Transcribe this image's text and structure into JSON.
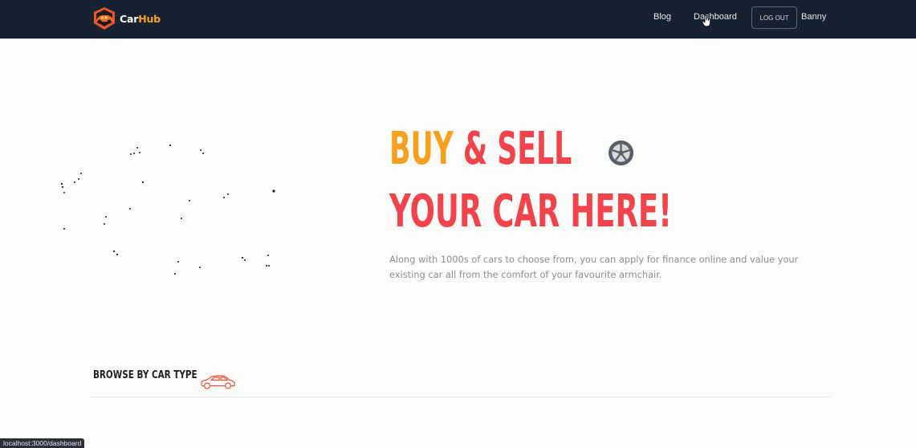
{
  "navbar": {
    "brand": {
      "logo_icon": "carhub-logo-icon",
      "name_part1": "Car",
      "name_part2": "Hub",
      "accent_color": "#f5a524"
    },
    "links": {
      "blog": "Blog",
      "dashboard": "Dashboard"
    },
    "logout_label": "LOG OUT",
    "username": "Banny",
    "background": "#17212f"
  },
  "hero": {
    "title_word1": "BUY",
    "title_word2": "& SELL",
    "title_line2": "YOUR CAR HERE!",
    "title_icon": "wheel-icon",
    "description": "Along with 1000s of cars to choose from, you can apply for finance online and value your existing car all from the comfort of your favourite armchair.",
    "colors": {
      "orange": "#f5a01f",
      "red": "#f1434b"
    }
  },
  "browse": {
    "title": "BROWSE BY CAR TYPE",
    "icon": "car-outline-icon"
  },
  "status_bar": {
    "url": "localhost:3000/dashboard"
  }
}
